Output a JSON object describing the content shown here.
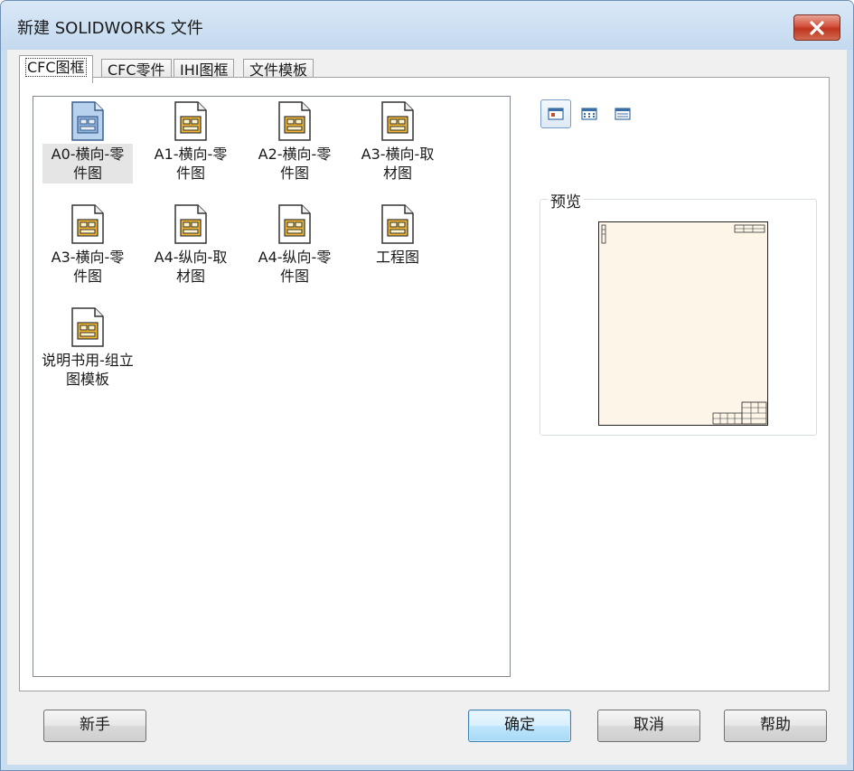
{
  "window": {
    "title": "新建 SOLIDWORKS 文件"
  },
  "tabs": [
    {
      "label": "CFC图框",
      "active": true
    },
    {
      "label": "CFC零件",
      "active": false
    },
    {
      "label": "IHI图框",
      "active": false
    },
    {
      "label": "文件模板",
      "active": false
    }
  ],
  "templates": [
    {
      "label": "A0-横向-零件图",
      "icon": "drawing-template-icon",
      "selected": true
    },
    {
      "label": "A1-横向-零件图",
      "icon": "drawing-template-icon"
    },
    {
      "label": "A2-横向-零件图",
      "icon": "drawing-template-icon"
    },
    {
      "label": "A3-横向-取材图",
      "icon": "drawing-template-icon"
    },
    {
      "label": "A3-横向-零件图",
      "icon": "drawing-template-icon"
    },
    {
      "label": "A4-纵向-取材图",
      "icon": "drawing-template-icon"
    },
    {
      "label": "A4-纵向-零件图",
      "icon": "drawing-template-icon"
    },
    {
      "label": "工程图",
      "icon": "drawing-template-icon"
    },
    {
      "label": "说明书用-组立图模板",
      "icon": "drawing-template-icon"
    }
  ],
  "view_modes": [
    {
      "icon": "large-icons-view-icon",
      "active": true
    },
    {
      "icon": "list-view-icon",
      "active": false
    },
    {
      "icon": "details-view-icon",
      "active": false
    }
  ],
  "preview": {
    "label": "预览"
  },
  "buttons": {
    "novice": "新手",
    "ok": "确定",
    "cancel": "取消",
    "help": "帮助"
  },
  "colors": {
    "title_bar": "#c4d9ef",
    "close_button": "#c0351f",
    "selection": "#e5e5e5",
    "default_button": "#bee6fd",
    "preview_sheet": "#fdf6e8"
  }
}
